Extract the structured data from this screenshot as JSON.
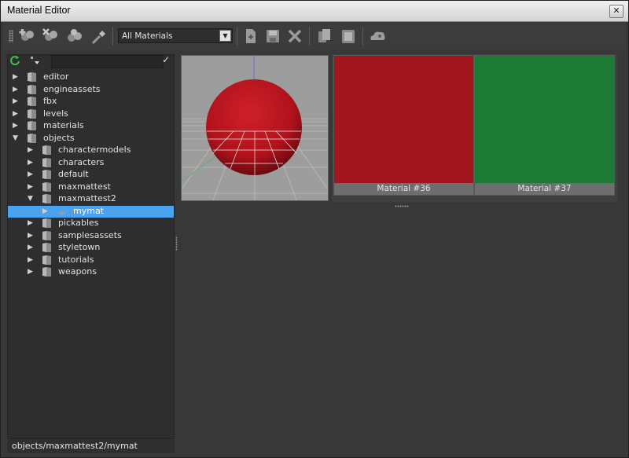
{
  "window": {
    "title": "Material Editor",
    "close_glyph": "✕"
  },
  "toolbar": {
    "filter_value": "All Materials",
    "buttons": [
      "add-material-icon",
      "remove-material-icon",
      "duplicate-material-icon",
      "pick-material-icon",
      "new-file-icon",
      "save-icon",
      "delete-icon",
      "copy-icon",
      "paste-icon",
      "preview-cloud-icon"
    ]
  },
  "tree": {
    "items": [
      {
        "label": "editor",
        "depth": 0,
        "expanded": false
      },
      {
        "label": "engineassets",
        "depth": 0,
        "expanded": false
      },
      {
        "label": "fbx",
        "depth": 0,
        "expanded": false
      },
      {
        "label": "levels",
        "depth": 0,
        "expanded": false
      },
      {
        "label": "materials",
        "depth": 0,
        "expanded": false
      },
      {
        "label": "objects",
        "depth": 0,
        "expanded": true
      },
      {
        "label": "charactermodels",
        "depth": 1,
        "expanded": false
      },
      {
        "label": "characters",
        "depth": 1,
        "expanded": false
      },
      {
        "label": "default",
        "depth": 1,
        "expanded": false
      },
      {
        "label": "maxmattest",
        "depth": 1,
        "expanded": false
      },
      {
        "label": "maxmattest2",
        "depth": 1,
        "expanded": true
      },
      {
        "label": "mymat",
        "depth": 2,
        "expanded": false,
        "selected": true
      },
      {
        "label": "pickables",
        "depth": 1,
        "expanded": false
      },
      {
        "label": "samplesassets",
        "depth": 1,
        "expanded": false
      },
      {
        "label": "styletown",
        "depth": 1,
        "expanded": false
      },
      {
        "label": "tutorials",
        "depth": 1,
        "expanded": false
      },
      {
        "label": "weapons",
        "depth": 1,
        "expanded": false
      }
    ]
  },
  "status": {
    "path": "objects/maxmattest2/mymat"
  },
  "materials": [
    {
      "name": "Material #36",
      "color": "#a0161c"
    },
    {
      "name": "Material #37",
      "color": "#1c7a34"
    }
  ],
  "colors": {
    "selection": "#4ba3f0",
    "refresh": "#3fbf4a"
  }
}
